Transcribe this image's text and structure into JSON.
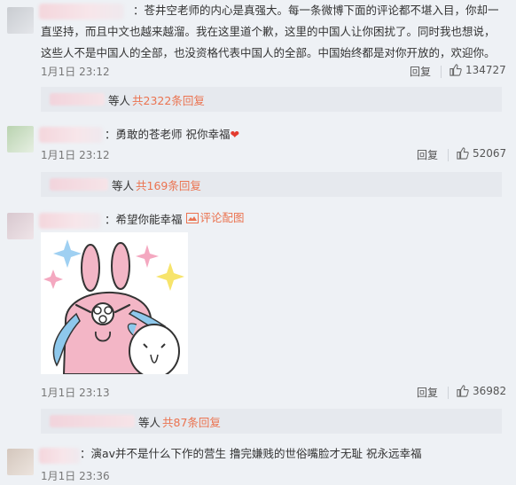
{
  "comments": [
    {
      "text": "：苍井空老师的内心是真强大。每一条微博下面的评论都不堪入目，你却一直坚持，而且中文也越来越溜。我在这里道个歉，这里的中国人让你困扰了。同时我也想说，这些人不是中国人的全部，也没资格代表中国人的全部。中国始终都是对你开放的，欢迎你。",
      "date": "1月1日 23:12",
      "reply_label": "回复",
      "likes": "134727",
      "sub_prefix": "等人",
      "sub_count": "共2322条回复"
    },
    {
      "text": "：勇敢的苍老师 祝你幸福",
      "emoji": "❤",
      "date": "1月1日 23:12",
      "reply_label": "回复",
      "likes": "52067",
      "sub_prefix": "等人",
      "sub_count": "共169条回复"
    },
    {
      "text": "：希望你能幸福",
      "pic_label": "评论配图",
      "date": "1月1日 23:13",
      "reply_label": "回复",
      "likes": "36982",
      "sub_prefix": "等人",
      "sub_count": "共87条回复"
    },
    {
      "text": "：演av并不是什么下作的营生 撸完嫌贱的世俗嘴脸才无耻 祝永远幸福",
      "date": "1月1日 23:36"
    }
  ],
  "colors": {
    "accent": "#eb7350",
    "heart": "#e33b2f"
  },
  "icons": [
    "like-icon",
    "picture-icon",
    "heart-emoji"
  ]
}
